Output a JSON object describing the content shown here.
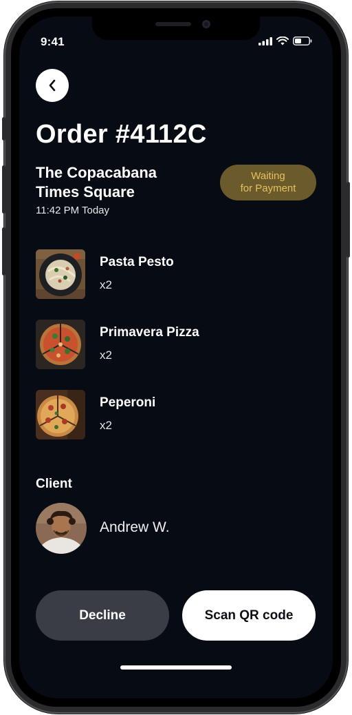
{
  "status_bar": {
    "time": "9:41"
  },
  "order": {
    "title": "Order #4112C",
    "venue_line1": "The Copacabana",
    "venue_line2": "Times Square",
    "time": "11:42 PM Today",
    "status_line1": "Waiting",
    "status_line2": "for Payment"
  },
  "items": [
    {
      "name": "Pasta Pesto",
      "qty": "x2"
    },
    {
      "name": "Primavera Pizza",
      "qty": "x2"
    },
    {
      "name": "Peperoni",
      "qty": "x2"
    }
  ],
  "client": {
    "label": "Client",
    "name": "Andrew W."
  },
  "actions": {
    "decline_label": "Decline",
    "scan_label": "Scan QR code"
  },
  "colors": {
    "background": "#070b13",
    "badge_bg": "#6b5a2b",
    "badge_text": "#e7c15d",
    "decline_bg": "#3a3d45",
    "primary_bg": "#ffffff"
  }
}
